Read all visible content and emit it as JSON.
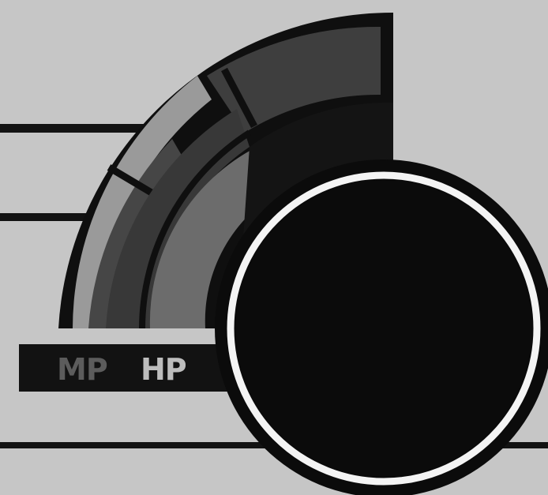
{
  "hud": {
    "mp_label": "MP",
    "hp_label": "HP"
  },
  "colors": {
    "background": "#c6c6c6",
    "frame": "#0f0f0f",
    "mp_track": "#9a9a9a",
    "mp_fill": "#464646",
    "hp_fill": "#6c6c6c",
    "quadrant_band_1": "#3e3e3e",
    "quadrant_band_2": "#282828",
    "label_bar": "#121212",
    "mp_label_color": "#5c5c5c",
    "hp_label_color": "#bdbdbd",
    "orb_fill": "#0b0b0b",
    "orb_ring": "#f4f4f4"
  },
  "icons": {
    "orb": "orb-icon"
  }
}
